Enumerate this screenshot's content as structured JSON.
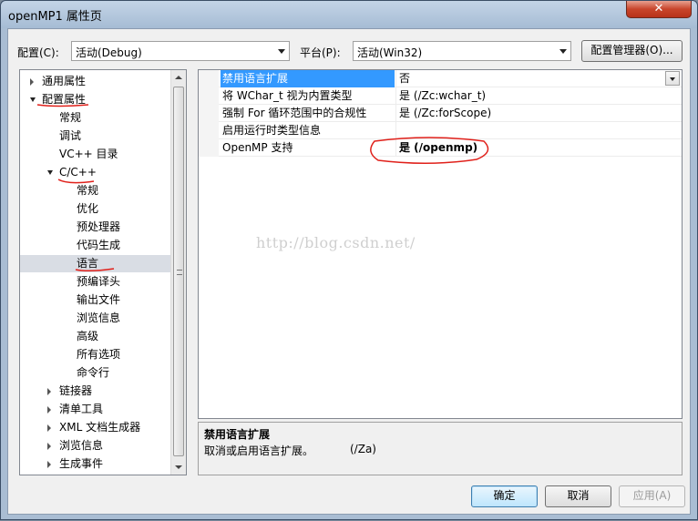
{
  "window": {
    "title": "openMP1 属性页",
    "close_glyph": "✕"
  },
  "toolbar": {
    "config_label": "配置(C):",
    "config_value": "活动(Debug)",
    "platform_label": "平台(P):",
    "platform_value": "活动(Win32)",
    "config_manager_label": "配置管理器(O)..."
  },
  "tree": {
    "items": [
      {
        "label": "通用属性",
        "state": "collapsed"
      },
      {
        "label": "配置属性",
        "state": "expanded"
      },
      {
        "label": "常规"
      },
      {
        "label": "调试"
      },
      {
        "label": "VC++ 目录"
      },
      {
        "label": "C/C++",
        "state": "expanded"
      },
      {
        "label": "常规"
      },
      {
        "label": "优化"
      },
      {
        "label": "预处理器"
      },
      {
        "label": "代码生成"
      },
      {
        "label": "语言",
        "selected": true
      },
      {
        "label": "预编译头"
      },
      {
        "label": "输出文件"
      },
      {
        "label": "浏览信息"
      },
      {
        "label": "高级"
      },
      {
        "label": "所有选项"
      },
      {
        "label": "命令行"
      },
      {
        "label": "链接器",
        "state": "collapsed"
      },
      {
        "label": "清单工具",
        "state": "collapsed"
      },
      {
        "label": "XML 文档生成器",
        "state": "collapsed"
      },
      {
        "label": "浏览信息",
        "state": "collapsed"
      },
      {
        "label": "生成事件",
        "state": "collapsed"
      }
    ]
  },
  "properties": [
    {
      "name": "禁用语言扩展",
      "value": "否",
      "selected": true
    },
    {
      "name": "将 WChar_t 视为内置类型",
      "value": "是 (/Zc:wchar_t)"
    },
    {
      "name": "强制 For 循环范围中的合规性",
      "value": "是 (/Zc:forScope)"
    },
    {
      "name": "启用运行时类型信息",
      "value": ""
    },
    {
      "name": "OpenMP 支持",
      "value": "是 (/openmp)",
      "bold": true
    }
  ],
  "description": {
    "title": "禁用语言扩展",
    "text": "取消或启用语言扩展。",
    "flag": "(/Za)"
  },
  "watermark": "http://blog.csdn.net/",
  "buttons": {
    "ok": "确定",
    "cancel": "取消",
    "apply": "应用(A)"
  },
  "colors": {
    "selection": "#3399ff",
    "annotation_red": "#e0201a"
  }
}
